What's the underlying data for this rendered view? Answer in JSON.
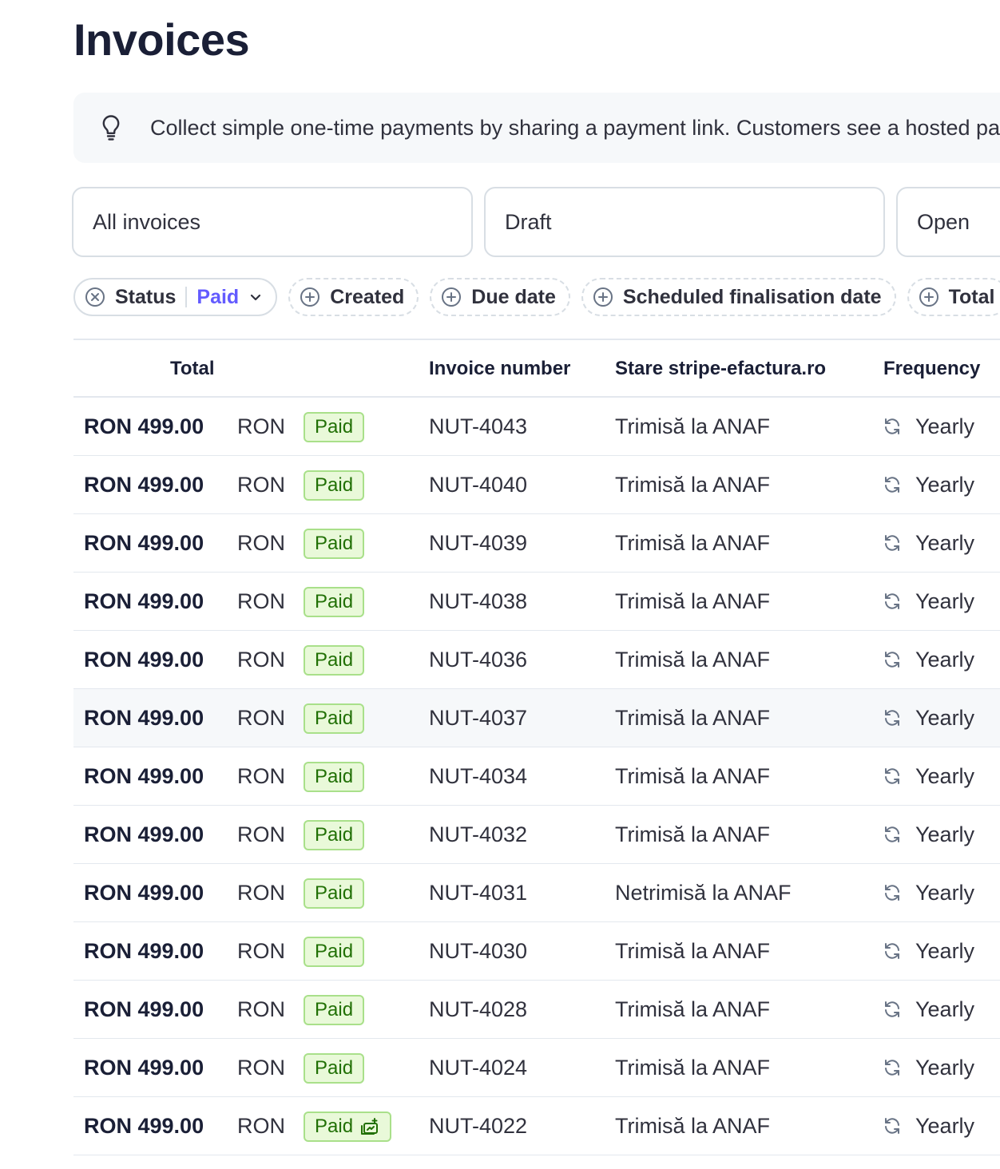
{
  "page": {
    "title": "Invoices"
  },
  "tip": {
    "text": "Collect simple one-time payments by sharing a payment link. Customers see a hosted payment page"
  },
  "tabs": [
    {
      "label": "All invoices"
    },
    {
      "label": "Draft"
    },
    {
      "label": "Open"
    }
  ],
  "filters": {
    "status": {
      "label": "Status",
      "value": "Paid"
    },
    "created": {
      "label": "Created"
    },
    "due_date": {
      "label": "Due date"
    },
    "scheduled": {
      "label": "Scheduled finalisation date"
    },
    "total": {
      "label": "Total"
    }
  },
  "table": {
    "headers": {
      "total": "Total",
      "invoice_number": "Invoice number",
      "stare": "Stare stripe-efactura.ro",
      "frequency": "Frequency"
    },
    "rows": [
      {
        "amount": "RON 499.00",
        "currency": "RON",
        "status": "Paid",
        "number": "NUT-4043",
        "stare": "Trimisă la ANAF",
        "frequency": "Yearly"
      },
      {
        "amount": "RON 499.00",
        "currency": "RON",
        "status": "Paid",
        "number": "NUT-4040",
        "stare": "Trimisă la ANAF",
        "frequency": "Yearly"
      },
      {
        "amount": "RON 499.00",
        "currency": "RON",
        "status": "Paid",
        "number": "NUT-4039",
        "stare": "Trimisă la ANAF",
        "frequency": "Yearly"
      },
      {
        "amount": "RON 499.00",
        "currency": "RON",
        "status": "Paid",
        "number": "NUT-4038",
        "stare": "Trimisă la ANAF",
        "frequency": "Yearly"
      },
      {
        "amount": "RON 499.00",
        "currency": "RON",
        "status": "Paid",
        "number": "NUT-4036",
        "stare": "Trimisă la ANAF",
        "frequency": "Yearly"
      },
      {
        "amount": "RON 499.00",
        "currency": "RON",
        "status": "Paid",
        "number": "NUT-4037",
        "stare": "Trimisă la ANAF",
        "frequency": "Yearly"
      },
      {
        "amount": "RON 499.00",
        "currency": "RON",
        "status": "Paid",
        "number": "NUT-4034",
        "stare": "Trimisă la ANAF",
        "frequency": "Yearly"
      },
      {
        "amount": "RON 499.00",
        "currency": "RON",
        "status": "Paid",
        "number": "NUT-4032",
        "stare": "Trimisă la ANAF",
        "frequency": "Yearly"
      },
      {
        "amount": "RON 499.00",
        "currency": "RON",
        "status": "Paid",
        "number": "NUT-4031",
        "stare": "Netrimisă la ANAF",
        "frequency": "Yearly"
      },
      {
        "amount": "RON 499.00",
        "currency": "RON",
        "status": "Paid",
        "number": "NUT-4030",
        "stare": "Trimisă la ANAF",
        "frequency": "Yearly"
      },
      {
        "amount": "RON 499.00",
        "currency": "RON",
        "status": "Paid",
        "number": "NUT-4028",
        "stare": "Trimisă la ANAF",
        "frequency": "Yearly"
      },
      {
        "amount": "RON 499.00",
        "currency": "RON",
        "status": "Paid",
        "number": "NUT-4024",
        "stare": "Trimisă la ANAF",
        "frequency": "Yearly"
      },
      {
        "amount": "RON 499.00",
        "currency": "RON",
        "status": "Paid",
        "number": "NUT-4022",
        "stare": "Trimisă la ANAF",
        "frequency": "Yearly"
      }
    ]
  },
  "colors": {
    "accent": "#635bff",
    "paid_bg": "#e9f9d9",
    "paid_border": "#a9e08a",
    "paid_text": "#217005"
  },
  "icons": [
    "lightbulb-icon",
    "clear-circle-icon",
    "chevron-down-icon",
    "plus-circle-icon",
    "repeat-icon",
    "invoice-sent-icon"
  ]
}
